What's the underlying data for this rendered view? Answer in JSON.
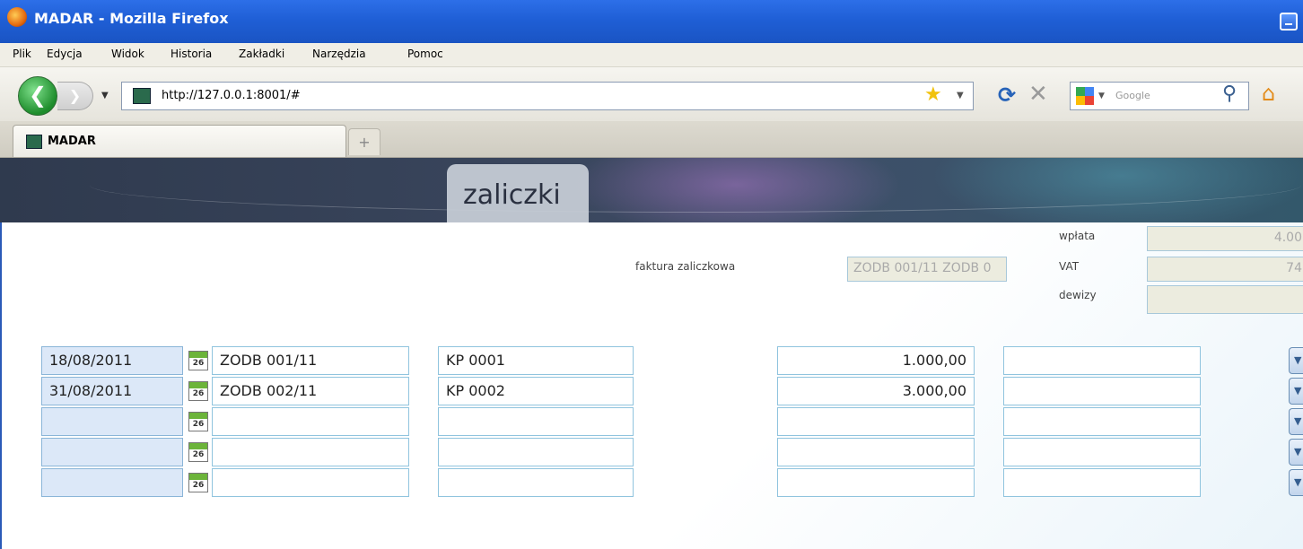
{
  "window": {
    "title": "MADAR - Mozilla Firefox"
  },
  "menu": [
    "Plik",
    "Edycja",
    "Widok",
    "Historia",
    "Zakładki",
    "Narzędzia",
    "Pomoc"
  ],
  "nav": {
    "url": "http://127.0.0.1:8001/#",
    "search_placeholder": "Google"
  },
  "tab": {
    "label": "MADAR",
    "new_tab": "+"
  },
  "page": {
    "title": "zaliczki"
  },
  "form": {
    "faktura_label": "faktura zaliczkowa",
    "faktura_value": "ZODB 001/11 ZODB 0",
    "wplata_label": "wpłata",
    "wplata_value": "4.00",
    "vat_label": "VAT",
    "vat_value": "74",
    "dewizy_label": "dewizy",
    "dewizy_value": ""
  },
  "rows": [
    {
      "date": "18/08/2011",
      "cal": "26",
      "doc": "ZODB 001/11",
      "kp": "KP 0001",
      "amount": "1.000,00",
      "extra": ""
    },
    {
      "date": "31/08/2011",
      "cal": "26",
      "doc": "ZODB 002/11",
      "kp": "KP 0002",
      "amount": "3.000,00",
      "extra": ""
    },
    {
      "date": "",
      "cal": "26",
      "doc": "",
      "kp": "",
      "amount": "",
      "extra": ""
    },
    {
      "date": "",
      "cal": "26",
      "doc": "",
      "kp": "",
      "amount": "",
      "extra": ""
    },
    {
      "date": "",
      "cal": "26",
      "doc": "",
      "kp": "",
      "amount": "",
      "extra": ""
    }
  ]
}
